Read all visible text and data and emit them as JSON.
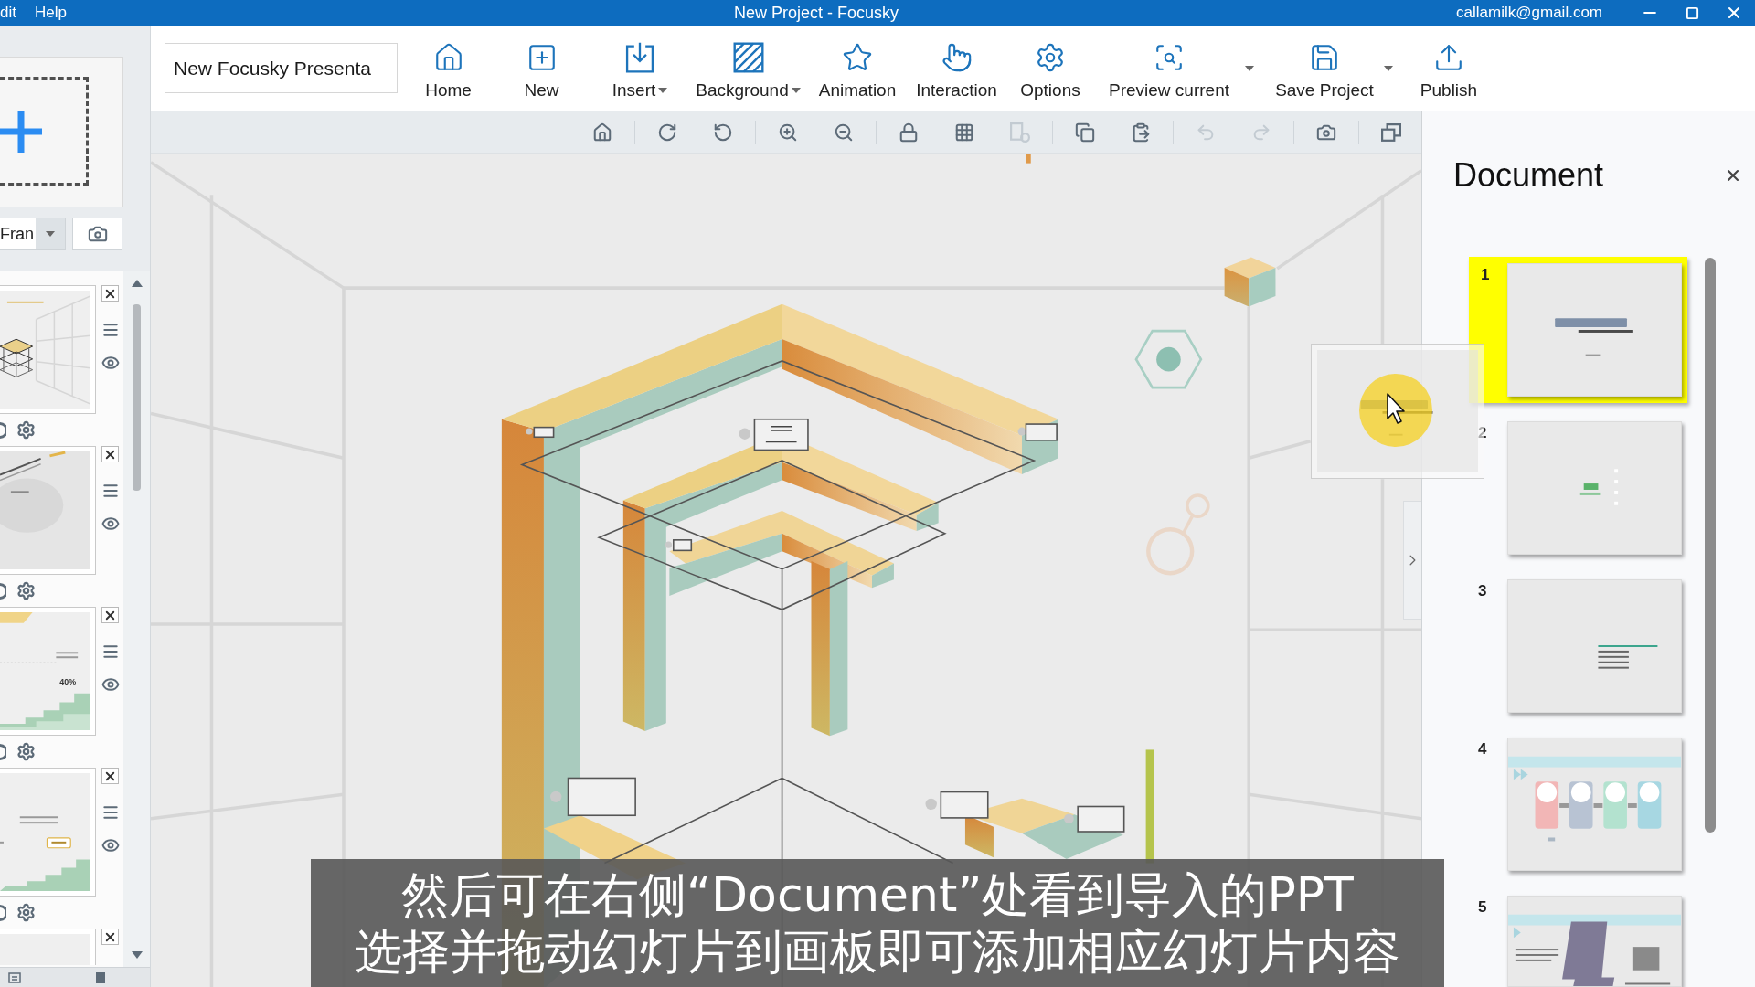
{
  "window": {
    "menus": [
      "dit",
      "Help"
    ],
    "title": "New Project - Focusky",
    "account": "callamilk@gmail.com"
  },
  "frames_panel": {
    "frame_type": "Fran",
    "frames": [
      {
        "kind": "isometric"
      },
      {
        "kind": "diagonal"
      },
      {
        "kind": "chart",
        "text": "40%"
      },
      {
        "kind": "stairs"
      },
      {
        "kind": "blank"
      }
    ]
  },
  "toolbar": {
    "presentation_name": "New Focusky Presenta",
    "buttons": [
      {
        "label": "Home",
        "kind": "plain"
      },
      {
        "label": "New",
        "kind": "plain"
      },
      {
        "label": "Insert",
        "kind": "menu"
      },
      {
        "label": "Background",
        "kind": "menu"
      },
      {
        "label": "Animation",
        "kind": "plain"
      },
      {
        "label": "Interaction",
        "kind": "plain"
      },
      {
        "label": "Options",
        "kind": "plain"
      },
      {
        "label": "Preview current",
        "kind": "split"
      },
      {
        "label": "Save Project",
        "kind": "split"
      },
      {
        "label": "Publish",
        "kind": "plain"
      }
    ]
  },
  "view_tools": [
    {
      "disabled": false
    },
    {
      "disabled": false
    },
    {
      "disabled": false
    },
    {
      "disabled": false
    },
    {
      "disabled": false
    },
    {
      "disabled": false
    },
    {
      "disabled": false
    },
    {
      "disabled": true
    },
    {
      "disabled": false
    },
    {
      "disabled": false
    },
    {
      "disabled": true
    },
    {
      "disabled": true
    },
    {
      "disabled": false
    },
    {
      "disabled": false
    }
  ],
  "document": {
    "title": "Document",
    "slides": [
      {
        "number": "1",
        "kind": "title",
        "selected": true
      },
      {
        "number": "2",
        "kind": "contents",
        "selected": false
      },
      {
        "number": "3",
        "kind": "list",
        "selected": false
      },
      {
        "number": "4",
        "kind": "steps",
        "selected": false
      },
      {
        "number": "5",
        "kind": "photo",
        "selected": false
      }
    ]
  },
  "drag_preview": {
    "kind": "title"
  },
  "subtitle": {
    "lines": [
      "然后可在右侧“Document”处看到导入的PPT",
      "选择并拖动幻灯片到画板即可添加相应幻灯片内容"
    ]
  }
}
